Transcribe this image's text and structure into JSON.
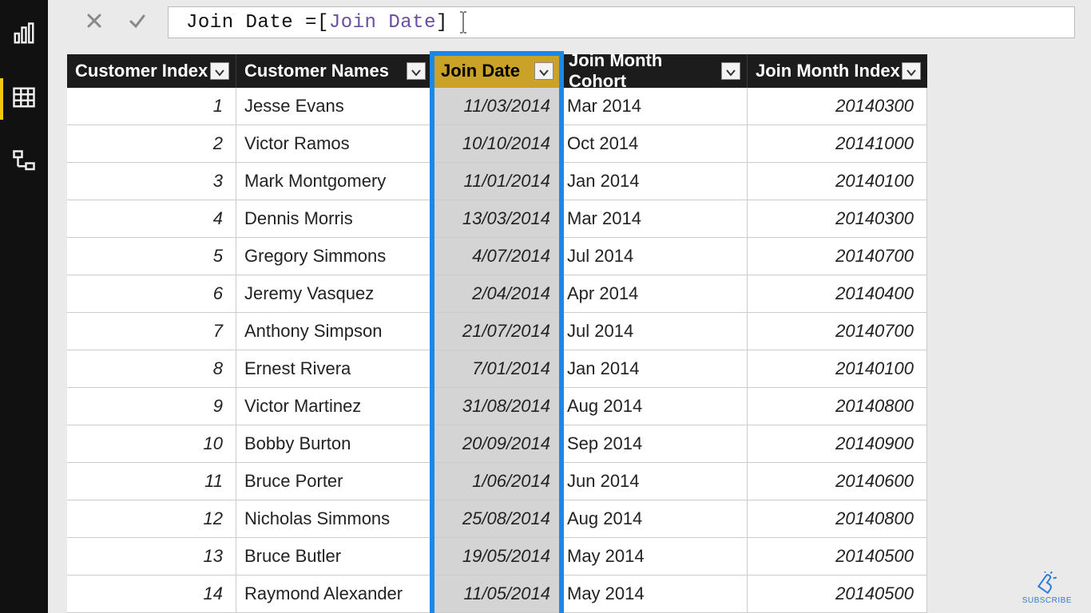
{
  "formula": {
    "prefix": "Join Date = ",
    "ref_open": "[",
    "ref_text": "Join Date",
    "ref_close": "]"
  },
  "columns": {
    "c0": "Customer Index",
    "c1": "Customer Names",
    "c2": "Join Date",
    "c3": "Join Month Cohort",
    "c4": "Join Month Index"
  },
  "rows": [
    {
      "idx": "1",
      "name": "Jesse Evans",
      "date": "11/03/2014",
      "cohort": "Mar 2014",
      "midx": "20140300"
    },
    {
      "idx": "2",
      "name": "Victor Ramos",
      "date": "10/10/2014",
      "cohort": "Oct 2014",
      "midx": "20141000"
    },
    {
      "idx": "3",
      "name": "Mark Montgomery",
      "date": "11/01/2014",
      "cohort": "Jan 2014",
      "midx": "20140100"
    },
    {
      "idx": "4",
      "name": "Dennis Morris",
      "date": "13/03/2014",
      "cohort": "Mar 2014",
      "midx": "20140300"
    },
    {
      "idx": "5",
      "name": "Gregory Simmons",
      "date": "4/07/2014",
      "cohort": "Jul 2014",
      "midx": "20140700"
    },
    {
      "idx": "6",
      "name": "Jeremy Vasquez",
      "date": "2/04/2014",
      "cohort": "Apr 2014",
      "midx": "20140400"
    },
    {
      "idx": "7",
      "name": "Anthony Simpson",
      "date": "21/07/2014",
      "cohort": "Jul 2014",
      "midx": "20140700"
    },
    {
      "idx": "8",
      "name": "Ernest Rivera",
      "date": "7/01/2014",
      "cohort": "Jan 2014",
      "midx": "20140100"
    },
    {
      "idx": "9",
      "name": "Victor Martinez",
      "date": "31/08/2014",
      "cohort": "Aug 2014",
      "midx": "20140800"
    },
    {
      "idx": "10",
      "name": "Bobby Burton",
      "date": "20/09/2014",
      "cohort": "Sep 2014",
      "midx": "20140900"
    },
    {
      "idx": "11",
      "name": "Bruce Porter",
      "date": "1/06/2014",
      "cohort": "Jun 2014",
      "midx": "20140600"
    },
    {
      "idx": "12",
      "name": "Nicholas Simmons",
      "date": "25/08/2014",
      "cohort": "Aug 2014",
      "midx": "20140800"
    },
    {
      "idx": "13",
      "name": "Bruce Butler",
      "date": "19/05/2014",
      "cohort": "May 2014",
      "midx": "20140500"
    },
    {
      "idx": "14",
      "name": "Raymond Alexander",
      "date": "11/05/2014",
      "cohort": "May 2014",
      "midx": "20140500"
    }
  ],
  "selected_column_index": 2,
  "subscribe_label": "SUBSCRIBE"
}
